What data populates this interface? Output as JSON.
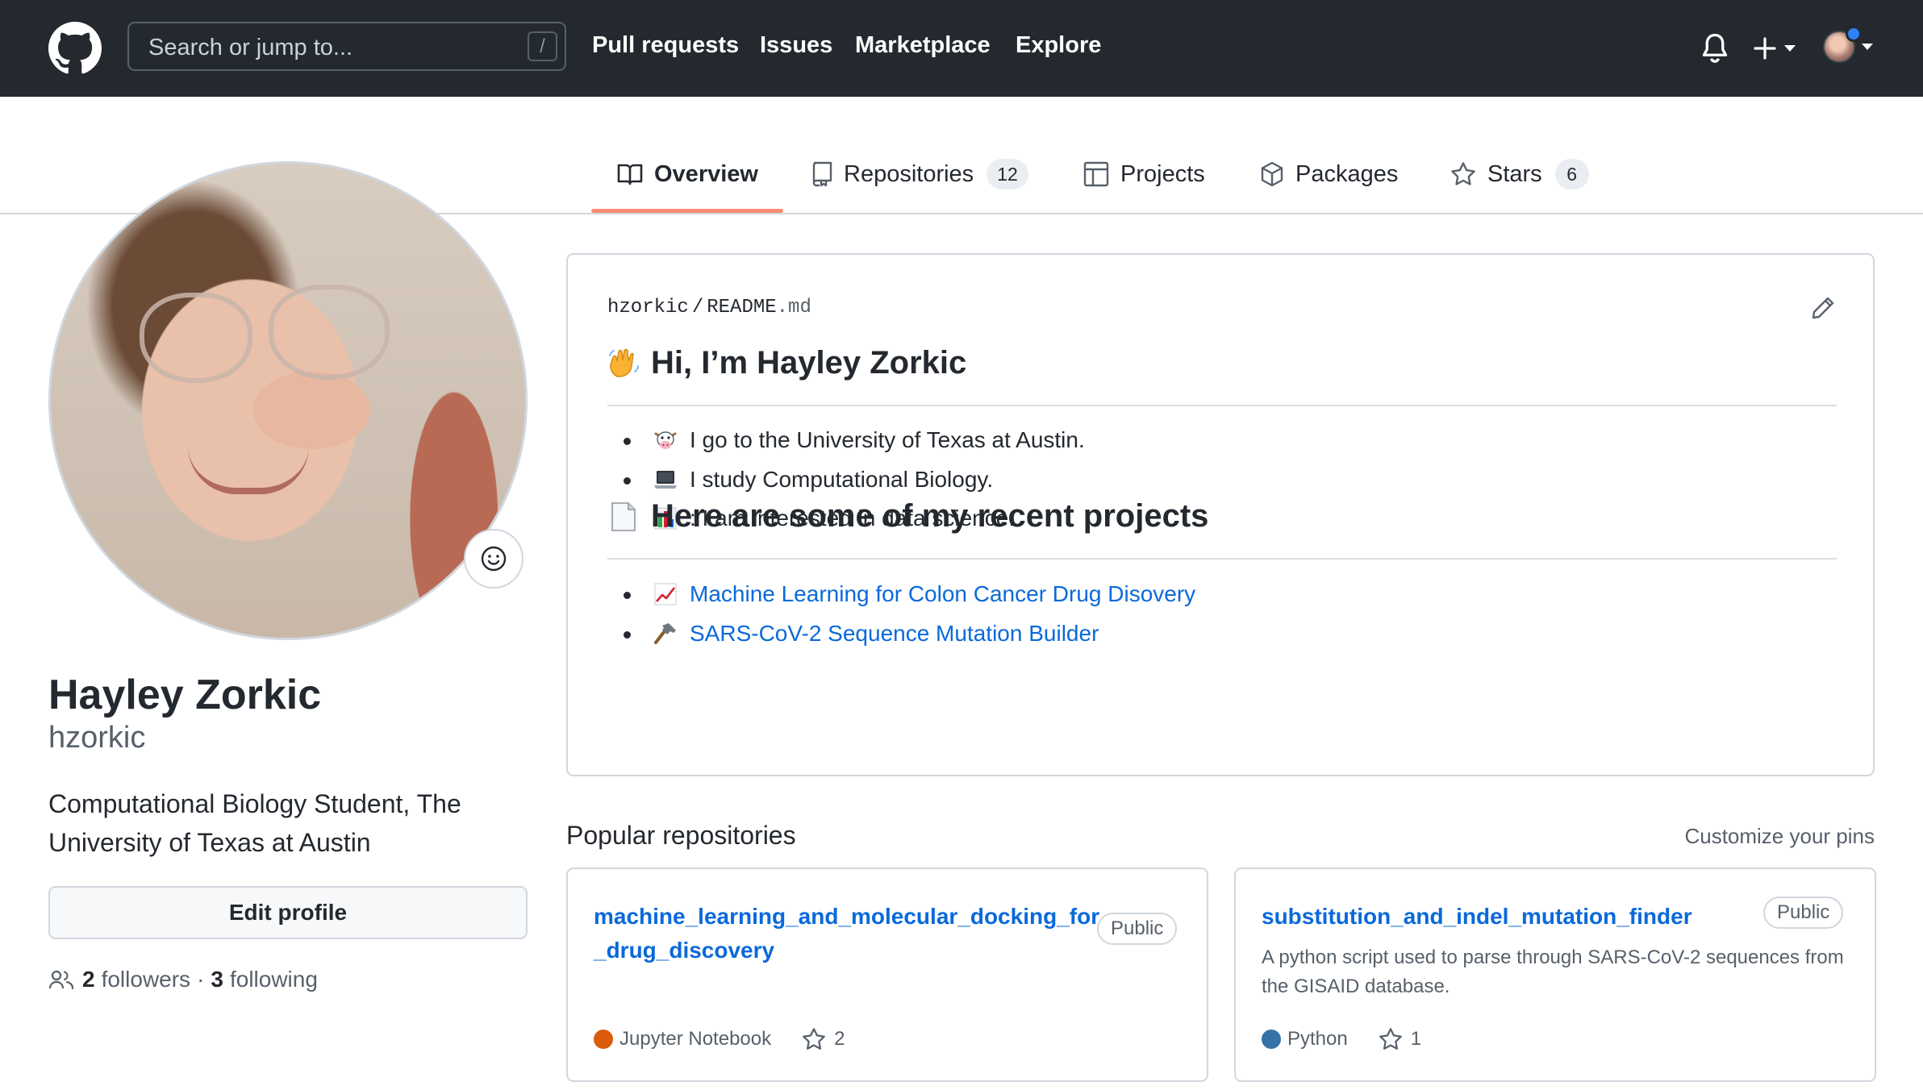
{
  "header": {
    "search_placeholder": "Search or jump to...",
    "search_shortcut": "/",
    "nav": [
      "Pull requests",
      "Issues",
      "Marketplace",
      "Explore"
    ],
    "notification_dot_color": "#2f81f7"
  },
  "tabs": [
    {
      "label": "Overview",
      "icon": "book-icon",
      "active": true
    },
    {
      "label": "Repositories",
      "icon": "repo-icon",
      "count": "12"
    },
    {
      "label": "Projects",
      "icon": "table-icon"
    },
    {
      "label": "Packages",
      "icon": "package-icon"
    },
    {
      "label": "Stars",
      "icon": "star-icon",
      "count": "6"
    }
  ],
  "profile": {
    "full_name": "Hayley Zorkic",
    "username": "hzorkic",
    "bio": "Computational Biology Student, The University of Texas at Austin",
    "edit_label": "Edit profile",
    "followers_count": "2",
    "followers_label": "followers",
    "separator": "·",
    "following_count": "3",
    "following_label": "following"
  },
  "readme": {
    "owner": "hzorkic",
    "path_sep": "/",
    "file": "README",
    "ext": ".md",
    "heading1": "Hi, I’m Hayley Zorkic",
    "heading1_emoji": "waving-hand-icon",
    "bullets": [
      {
        "emoji": "cow-icon",
        "text": "I go to the University of Texas at Austin."
      },
      {
        "emoji": "laptop-icon",
        "text": "I study Computational Biology."
      },
      {
        "emoji": "bar-chart-icon",
        "text": ": I am interested in data science."
      }
    ],
    "heading2": "Here are some of my recent projects",
    "heading2_emoji": "page-icon",
    "projects": [
      {
        "emoji": "chart-increasing-icon",
        "text": "Machine Learning for Colon Cancer Drug Disovery"
      },
      {
        "emoji": "hammer-icon",
        "text": "SARS-CoV-2 Sequence Mutation Builder"
      }
    ]
  },
  "popular": {
    "title": "Popular repositories",
    "customize": "Customize your pins",
    "repos": [
      {
        "name_line1": "machine_learning_and_molecular_docking_for",
        "name_line2": "_drug_discovery",
        "visibility": "Public",
        "description": "",
        "language": "Jupyter Notebook",
        "language_color": "#DA5B0B",
        "stars": "2"
      },
      {
        "name_line1": "substitution_and_indel_mutation_finder",
        "name_line2": "",
        "visibility": "Public",
        "description": "A python script used to parse through SARS-CoV-2 sequences from the GISAID database.",
        "language": "Python",
        "language_color": "#3572A5",
        "stars": "1"
      }
    ]
  },
  "colors": {
    "header_bg": "#24292f",
    "link": "#0969da",
    "tab_underline": "#fd8c73"
  }
}
